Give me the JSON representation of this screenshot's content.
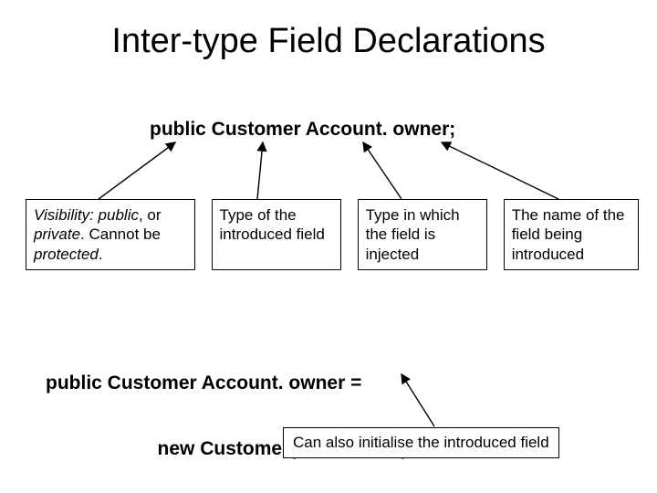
{
  "title": "Inter-type Field Declarations",
  "code1": "public Customer Account. owner;",
  "boxes": {
    "b1_pre": "Visibility: ",
    "b1_public": "public",
    "b1_mid": ", or ",
    "b1_private": "private",
    "b1_mid2": ". Cannot be ",
    "b1_protected": "protected",
    "b1_end": ".",
    "b2": "Type of the introduced field",
    "b3": "Type in which the field is injected",
    "b4": "The name of the field being introduced"
  },
  "code2a": "public Customer Account. owner =",
  "code2b": "                     new Customer(\"John Doe\");",
  "init_box": "Can also initialise the introduced field"
}
